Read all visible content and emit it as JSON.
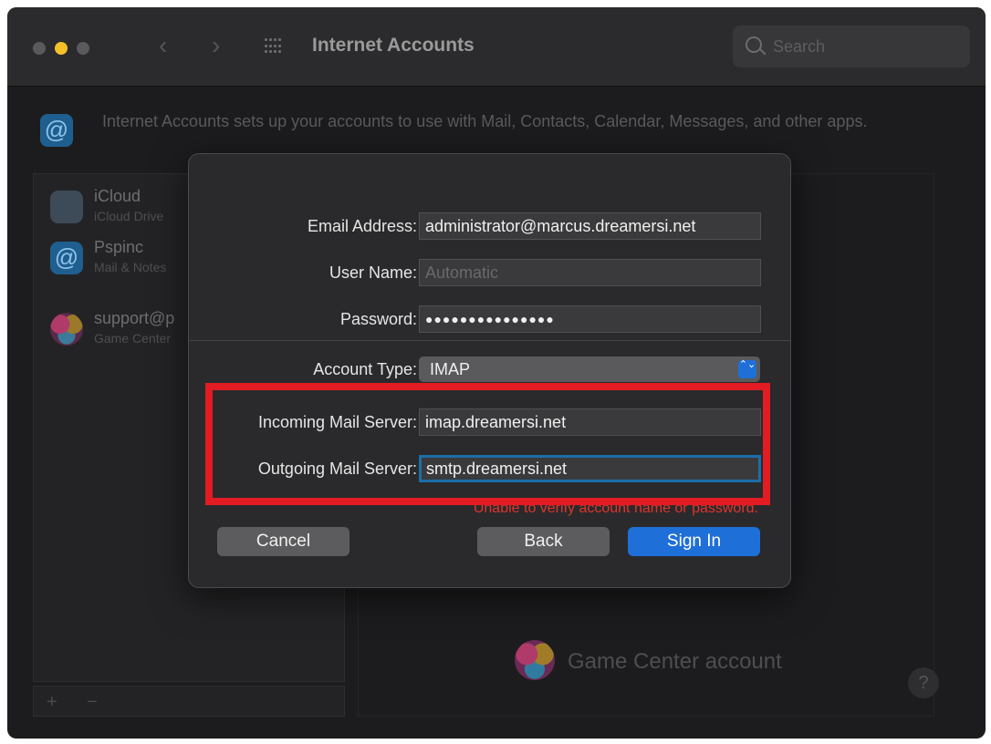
{
  "window": {
    "title": "Internet Accounts",
    "search_placeholder": "Search",
    "nav_back": "‹",
    "nav_forward": "›"
  },
  "header": {
    "icon_glyph": "@",
    "description": "Internet Accounts sets up your accounts to use with Mail, Contacts, Calendar, Messages, and other apps."
  },
  "sidebar": {
    "accounts": [
      {
        "name": "iCloud",
        "subtitle": "iCloud Drive",
        "icon": "icloud-icon"
      },
      {
        "name": "Pspinc",
        "subtitle": "Mail & Notes",
        "icon": "at-icon"
      },
      {
        "name": "support@p",
        "subtitle": "Game Center",
        "icon": "game-center-icon"
      }
    ],
    "add_label": "+",
    "remove_label": "−"
  },
  "right_panel": {
    "game_center_label": "Game Center account",
    "help_label": "?"
  },
  "dialog": {
    "email_label": "Email Address:",
    "email_value": "administrator@marcus.dreamersi.net",
    "username_label": "User Name:",
    "username_placeholder": "Automatic",
    "password_label": "Password:",
    "password_value": "●●●●●●●●●●●●●●●",
    "account_type_label": "Account Type:",
    "account_type_value": "IMAP",
    "select_arrows": "⌃⌄",
    "incoming_label": "Incoming Mail Server:",
    "incoming_value": "imap.dreamersi.net",
    "outgoing_label": "Outgoing Mail Server:",
    "outgoing_value": "smtp.dreamersi.net",
    "error": "Unable to verify account name or password.",
    "cancel": "Cancel",
    "back": "Back",
    "sign_in": "Sign In"
  },
  "colors": {
    "accent": "#1f6fd8",
    "highlight": "#e31b23",
    "error": "#e0342c"
  }
}
